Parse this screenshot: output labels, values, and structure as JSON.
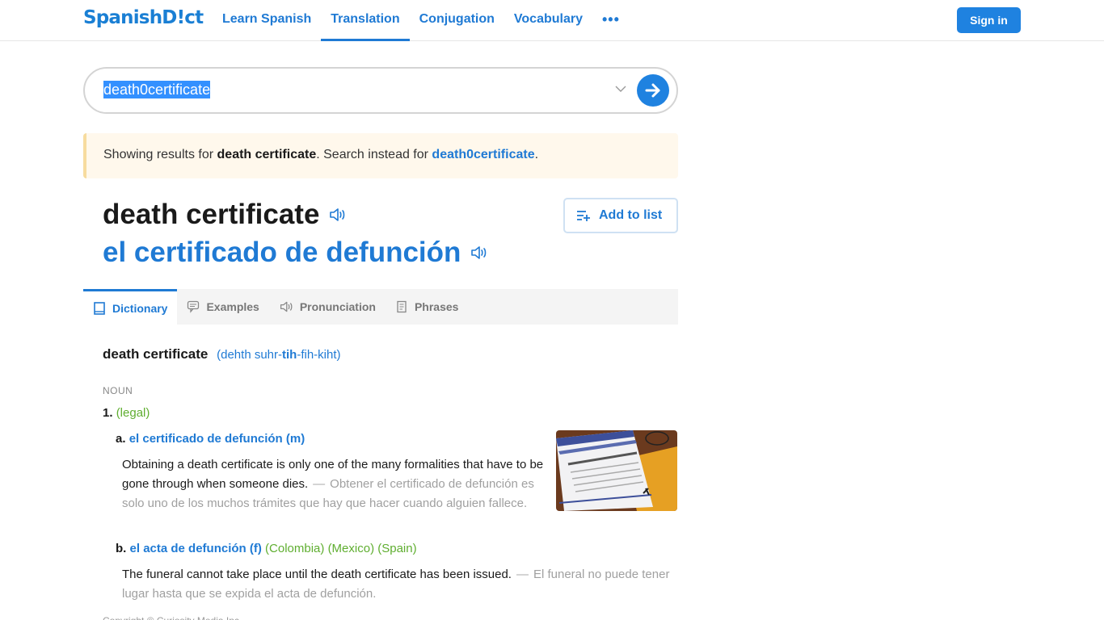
{
  "header": {
    "logo": "SpanishD!ct",
    "nav": [
      {
        "label": "Learn Spanish",
        "active": false
      },
      {
        "label": "Translation",
        "active": true
      },
      {
        "label": "Conjugation",
        "active": false
      },
      {
        "label": "Vocabulary",
        "active": false
      }
    ],
    "more_label": "•••",
    "signin_label": "Sign in"
  },
  "search": {
    "value": "death0certificate",
    "icon_dropdown": "chevron-down-icon",
    "icon_go": "arrow-right-icon"
  },
  "notice": {
    "prefix": "Showing results for ",
    "corrected": "death certificate",
    "middle": ". Search instead for ",
    "original": "death0certificate",
    "suffix": "."
  },
  "headword": {
    "english": "death certificate",
    "spanish": "el certificado de defunción",
    "add_to_list_label": "Add to list"
  },
  "tabs": [
    {
      "label": "Dictionary",
      "icon": "book-icon",
      "active": true
    },
    {
      "label": "Examples",
      "icon": "speech-bubble-icon",
      "active": false
    },
    {
      "label": "Pronunciation",
      "icon": "speaker-icon",
      "active": false
    },
    {
      "label": "Phrases",
      "icon": "document-icon",
      "active": false
    }
  ],
  "entry": {
    "word": "death certificate",
    "pron_pre": "(dehth suhr-",
    "pron_stress": "tih",
    "pron_post": "-fih-kiht)",
    "pos": "NOUN",
    "sense_number": "1.",
    "sense_context": "(legal)",
    "subsenses": [
      {
        "letter": "a.",
        "translation": "el certificado de defunción (m)",
        "regions": "",
        "example_en": "Obtaining a death certificate is only one of the many formalities that have to be gone through when someone dies.",
        "example_es": "Obtener el certificado de defunción es solo uno de los muchos trámites que hay que hacer cuando alguien fallece."
      },
      {
        "letter": "b.",
        "translation": "el acta de defunción (f)",
        "regions": "(Colombia) (Mexico) (Spain)",
        "example_en": "The funeral cannot take place until the death certificate has been issued.",
        "example_es": "El funeral no puede tener lugar hasta que se expida el acta de defunción."
      }
    ],
    "dash": "—",
    "image_alt": "Certificate of Death document with glasses"
  },
  "footer_partial": "Copyright © Curiosity Media Inc."
}
